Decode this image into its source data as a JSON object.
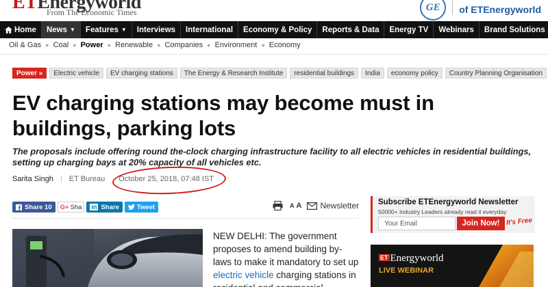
{
  "brand": {
    "logo_text": "Energyworld",
    "logo_prefix": "ET",
    "subtitle": "From The Economic Times",
    "partner_logo": "GE",
    "partner_text": "of ETEnergyworld"
  },
  "nav": {
    "items": [
      {
        "label": "Home",
        "icon": "home-icon"
      },
      {
        "label": "News",
        "dropdown": true,
        "active": true
      },
      {
        "label": "Features",
        "dropdown": true
      },
      {
        "label": "Interviews"
      },
      {
        "label": "International"
      },
      {
        "label": "Economy & Policy"
      },
      {
        "label": "Reports & Data"
      },
      {
        "label": "Energy TV"
      },
      {
        "label": "Webinars"
      },
      {
        "label": "Brand Solutions",
        "dropdown": true
      }
    ],
    "caret": "▼",
    "search_icon": "search-icon"
  },
  "subnav": {
    "items": [
      "Oil & Gas",
      "Coal",
      "Power",
      "Renewable",
      "Companies",
      "Environment",
      "Economy"
    ],
    "active": "Power",
    "separator": "●"
  },
  "tags": {
    "primary": "Power »",
    "items": [
      "Electric vehicle",
      "EV charging stations",
      "The Energy & Research Institute",
      "residential buildings",
      "India",
      "economy policy",
      "Country Planning Organisation"
    ]
  },
  "article": {
    "headline": "EV charging stations may become must in buildings, parking lots",
    "summary": "The proposals include offering round the-clock charging infrastructure facility to all electric vehicles in residential buildings, setting up charging bays at 20% capacity of all vehicles etc.",
    "author": "Sarita Singh",
    "source": "ET Bureau",
    "date": "October 25, 2018, 07:48 IST",
    "body_lead": "NEW DELHI: The government proposes to amend building by-laws to make it mandatory to set up ",
    "body_link": "electric vehicle",
    "body_tail": " charging stations in residential and commercial"
  },
  "share": {
    "facebook": "Share 10",
    "gplus_g": "G+",
    "gplus": "Sha",
    "linkedin_in": "in",
    "linkedin": "Share",
    "twitter": "Tweet"
  },
  "tools": {
    "print_icon": "print-icon",
    "font_small": "A",
    "font_large": "A",
    "newsletter_label": "Newsletter"
  },
  "newsletter": {
    "title": "Subscribe ETEnergyworld Newsletter",
    "subtitle": "50000+ Industry Leaders already read it everyday",
    "email_placeholder": "Your Email",
    "join_label": "Join Now!",
    "free_label": "It's Free"
  },
  "webinar_ad": {
    "logo_prefix": "ET",
    "logo_text": "Energyworld",
    "live_label": "LIVE WEBINAR"
  },
  "colors": {
    "accent_red": "#d7261e",
    "nav_black": "#111111",
    "link_blue": "#1a6db5",
    "annotation_red": "#d11a1a"
  }
}
